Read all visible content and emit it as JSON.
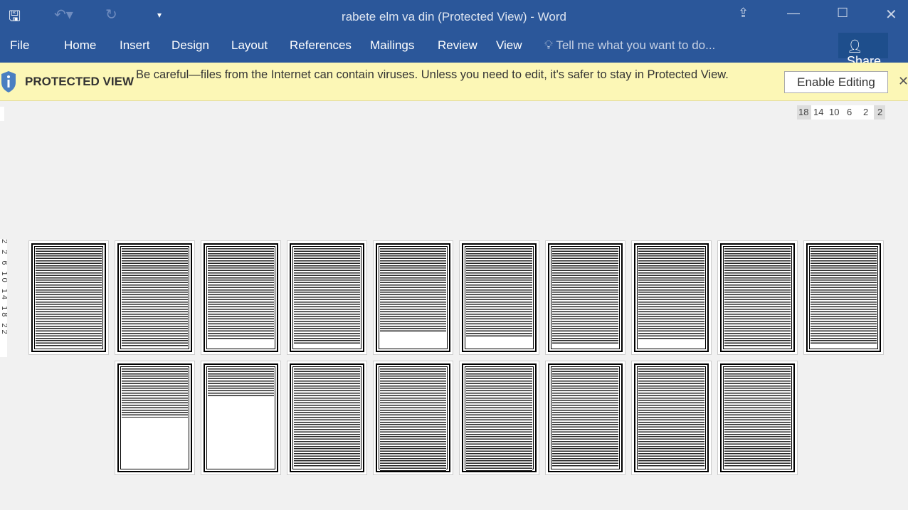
{
  "window": {
    "title": "rabete elm va din (Protected View) - Word"
  },
  "qat": {
    "save_icon": "save-icon",
    "undo_icon": "undo-icon",
    "redo_icon": "redo-icon",
    "customize_icon": "customize-qat-icon"
  },
  "ribbon": {
    "tabs": [
      "File",
      "Home",
      "Insert",
      "Design",
      "Layout",
      "References",
      "Mailings",
      "Review",
      "View"
    ],
    "tell_me": "Tell me what you want to do...",
    "share": "Share"
  },
  "protected_view": {
    "label": "PROTECTED VIEW",
    "message": "Be careful—files from the Internet can contain viruses. Unless you need to edit, it's safer to stay in Protected View.",
    "enable_button": "Enable Editing"
  },
  "ruler": {
    "numbers": [
      "18",
      "14",
      "10",
      "6",
      "2",
      "2"
    ]
  },
  "vertical_ruler": {
    "numbers": "2 2 6 10 14 18 22"
  },
  "document": {
    "page_rows": [
      10,
      8
    ]
  },
  "colors": {
    "ribbon": "#2b579a",
    "message_bar": "#fcf7b6"
  }
}
